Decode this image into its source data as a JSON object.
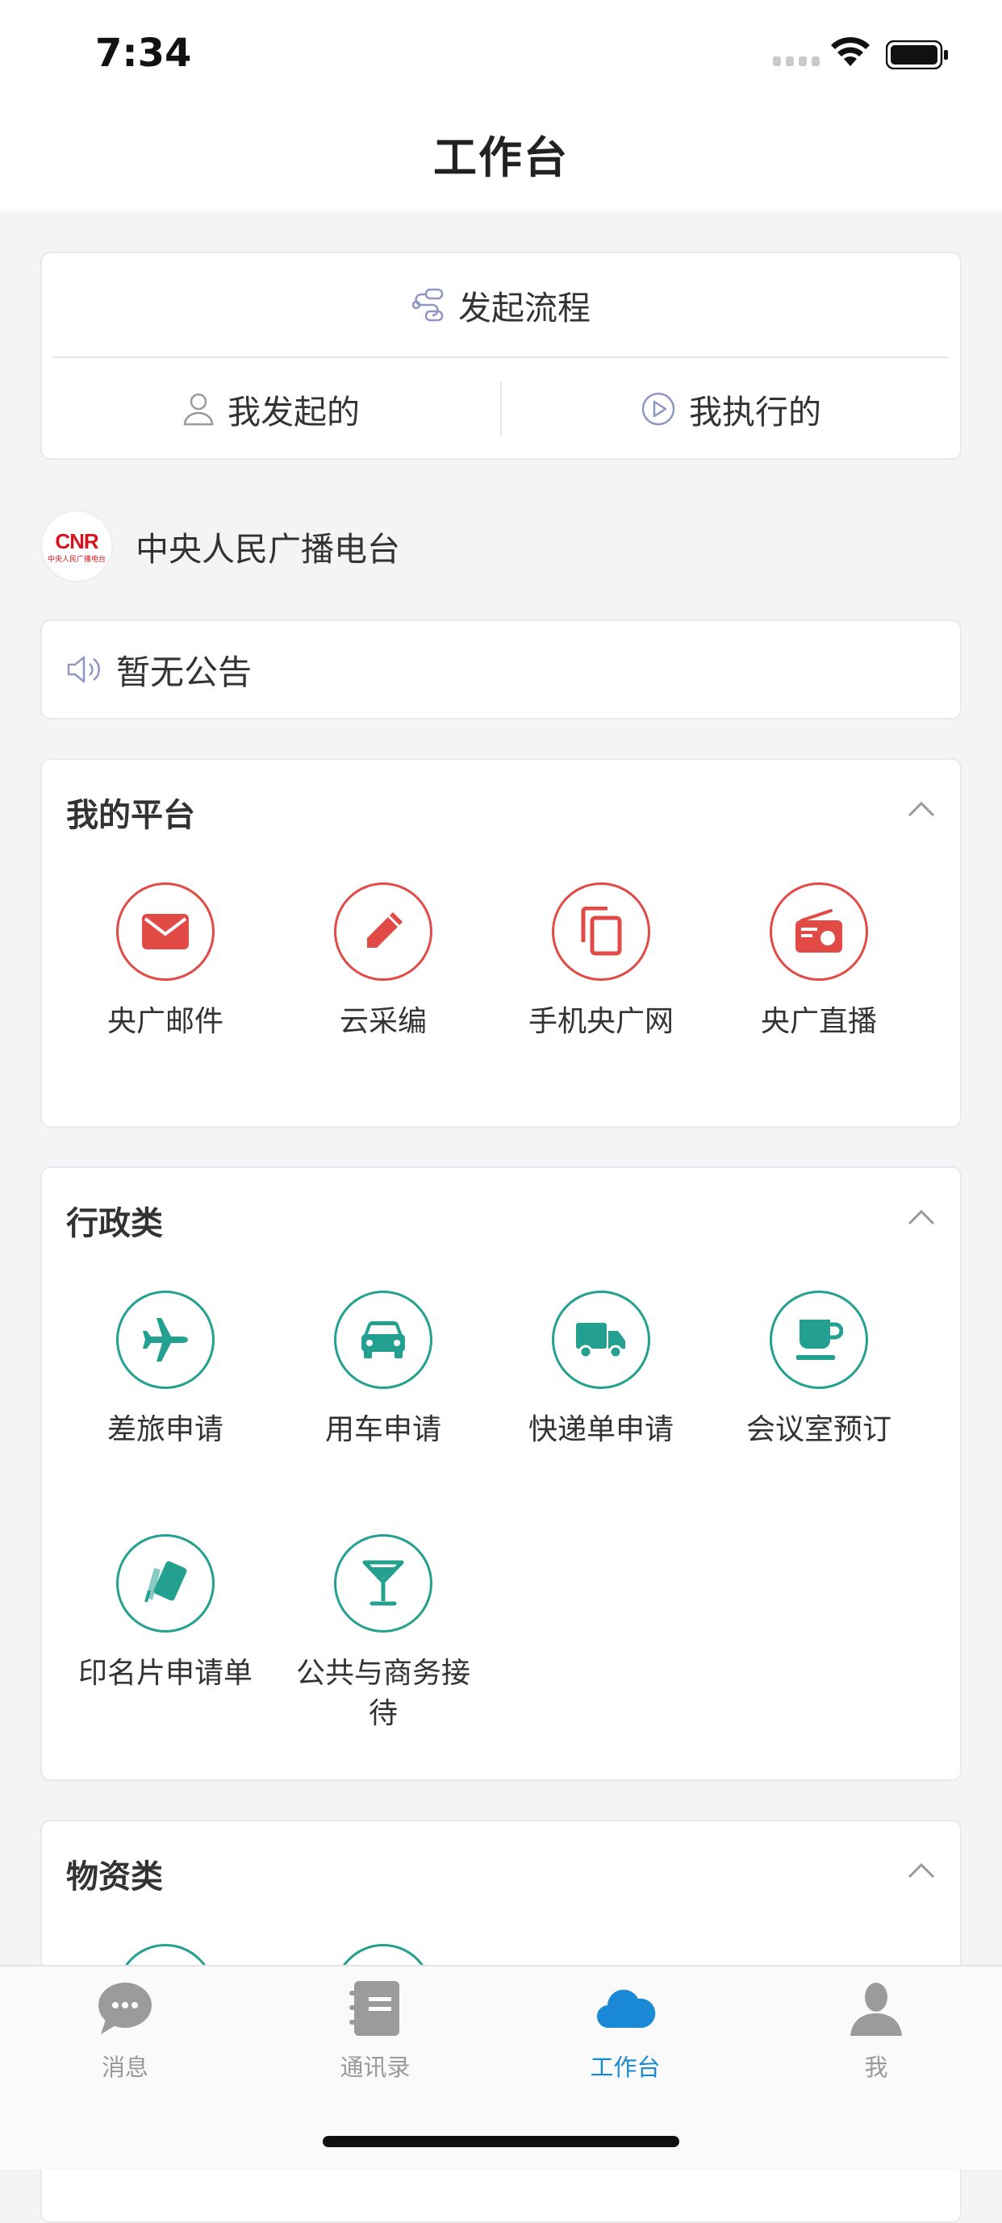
{
  "status_bar": {
    "time": "7:34"
  },
  "header": {
    "title": "工作台"
  },
  "flow": {
    "start_label": "发起流程",
    "initiated_label": "我发起的",
    "executed_label": "我执行的"
  },
  "org": {
    "logo_text": "CNR",
    "logo_subtext": "中央人民广播电台",
    "name": "中央人民广播电台"
  },
  "announcement": {
    "text": "暂无公告"
  },
  "sections": {
    "platform": {
      "title": "我的平台",
      "accent": "#e24a46",
      "items": [
        {
          "label": "央广邮件",
          "icon": "mail-icon"
        },
        {
          "label": "云采编",
          "icon": "pencil-icon"
        },
        {
          "label": "手机央广网",
          "icon": "copy-icon"
        },
        {
          "label": "央广直播",
          "icon": "radio-icon"
        }
      ]
    },
    "admin": {
      "title": "行政类",
      "accent": "#23a08f",
      "items": [
        {
          "label": "差旅申请",
          "icon": "airplane-icon"
        },
        {
          "label": "用车申请",
          "icon": "car-icon"
        },
        {
          "label": "快递单申请",
          "icon": "truck-icon"
        },
        {
          "label": "会议室预订",
          "icon": "coffee-cup-icon"
        },
        {
          "label": "印名片申请单",
          "icon": "business-card-icon"
        },
        {
          "label": "公共与商务接待",
          "icon": "cocktail-icon"
        }
      ]
    },
    "material": {
      "title": "物资类"
    }
  },
  "tabbar": {
    "active_color": "#1a8ad6",
    "tabs": [
      {
        "label": "消息",
        "icon": "chat-bubble-icon"
      },
      {
        "label": "通讯录",
        "icon": "contacts-book-icon"
      },
      {
        "label": "工作台",
        "icon": "cloud-icon",
        "active": true
      },
      {
        "label": "我",
        "icon": "user-icon"
      }
    ]
  }
}
